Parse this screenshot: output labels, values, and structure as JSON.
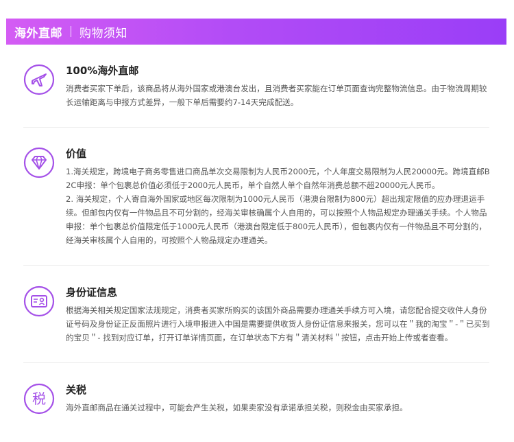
{
  "header": {
    "title": "海外直邮",
    "subtitle": "购物须知"
  },
  "colors": {
    "accent": "#b24cf6",
    "icon_stroke": "#a450e8"
  },
  "sections": [
    {
      "icon": "airplane-icon",
      "title": "100%海外直邮",
      "paragraphs": [
        "消费者买家下单后，该商品将从海外国家或港澳台发出，且消费者买家能在订单页面查询完整物流信息。由于物流周期较长运输距离与申报方式差异，一般下单后需要约7-14天完成配送。"
      ]
    },
    {
      "icon": "diamond-icon",
      "title": "价值",
      "paragraphs": [
        "1.海关规定，跨境电子商务零售进口商品单次交易限制为人民币2000元，个人年度交易限制为人民20000元。跨境直邮B2C申报：单个包裹总价值必须低于2000元人民币，单个自然人单个自然年消费总额不超20000元人民币。",
        "2. 海关规定，个人寄自海外国家或地区每次限制为1000元人民币（港澳台限制为800元）超出规定限值的应办理退运手续。但邮包内仅有一件物品且不可分割的，经海关审核确属个人自用的，可以按照个人物品规定办理通关手续。个人物品申报：单个包裹总价值限定低于1000元人民币（港澳台限定低于800元人民币），但包裹内仅有一件物品且不可分割的，经海关审核属个人自用的，可按照个人物品规定办理通关。"
      ]
    },
    {
      "icon": "id-card-icon",
      "title": "身份证信息",
      "paragraphs": [
        "根据海关相关规定国家法规规定，消费者买家所购买的该国外商品需要办理通关手续方可入境，请您配合提交收件人身份证号码及身份证正反面照片进行入境申报进入中国是需要提供收货人身份证信息来报关，您可以在＂我的淘宝＂-＂已买到的宝贝＂- 找到对应订单，打开订单详情页面，在订单状态下方有＂清关材料＂按钮，点击开始上传或者查看。"
      ]
    },
    {
      "icon": "tax-icon",
      "icon_text": "税",
      "title": "关税",
      "paragraphs": [
        "海外直邮商品在通关过程中，可能会产生关税，如果卖家没有承诺承担关税，则税金由买家承担。"
      ]
    }
  ]
}
